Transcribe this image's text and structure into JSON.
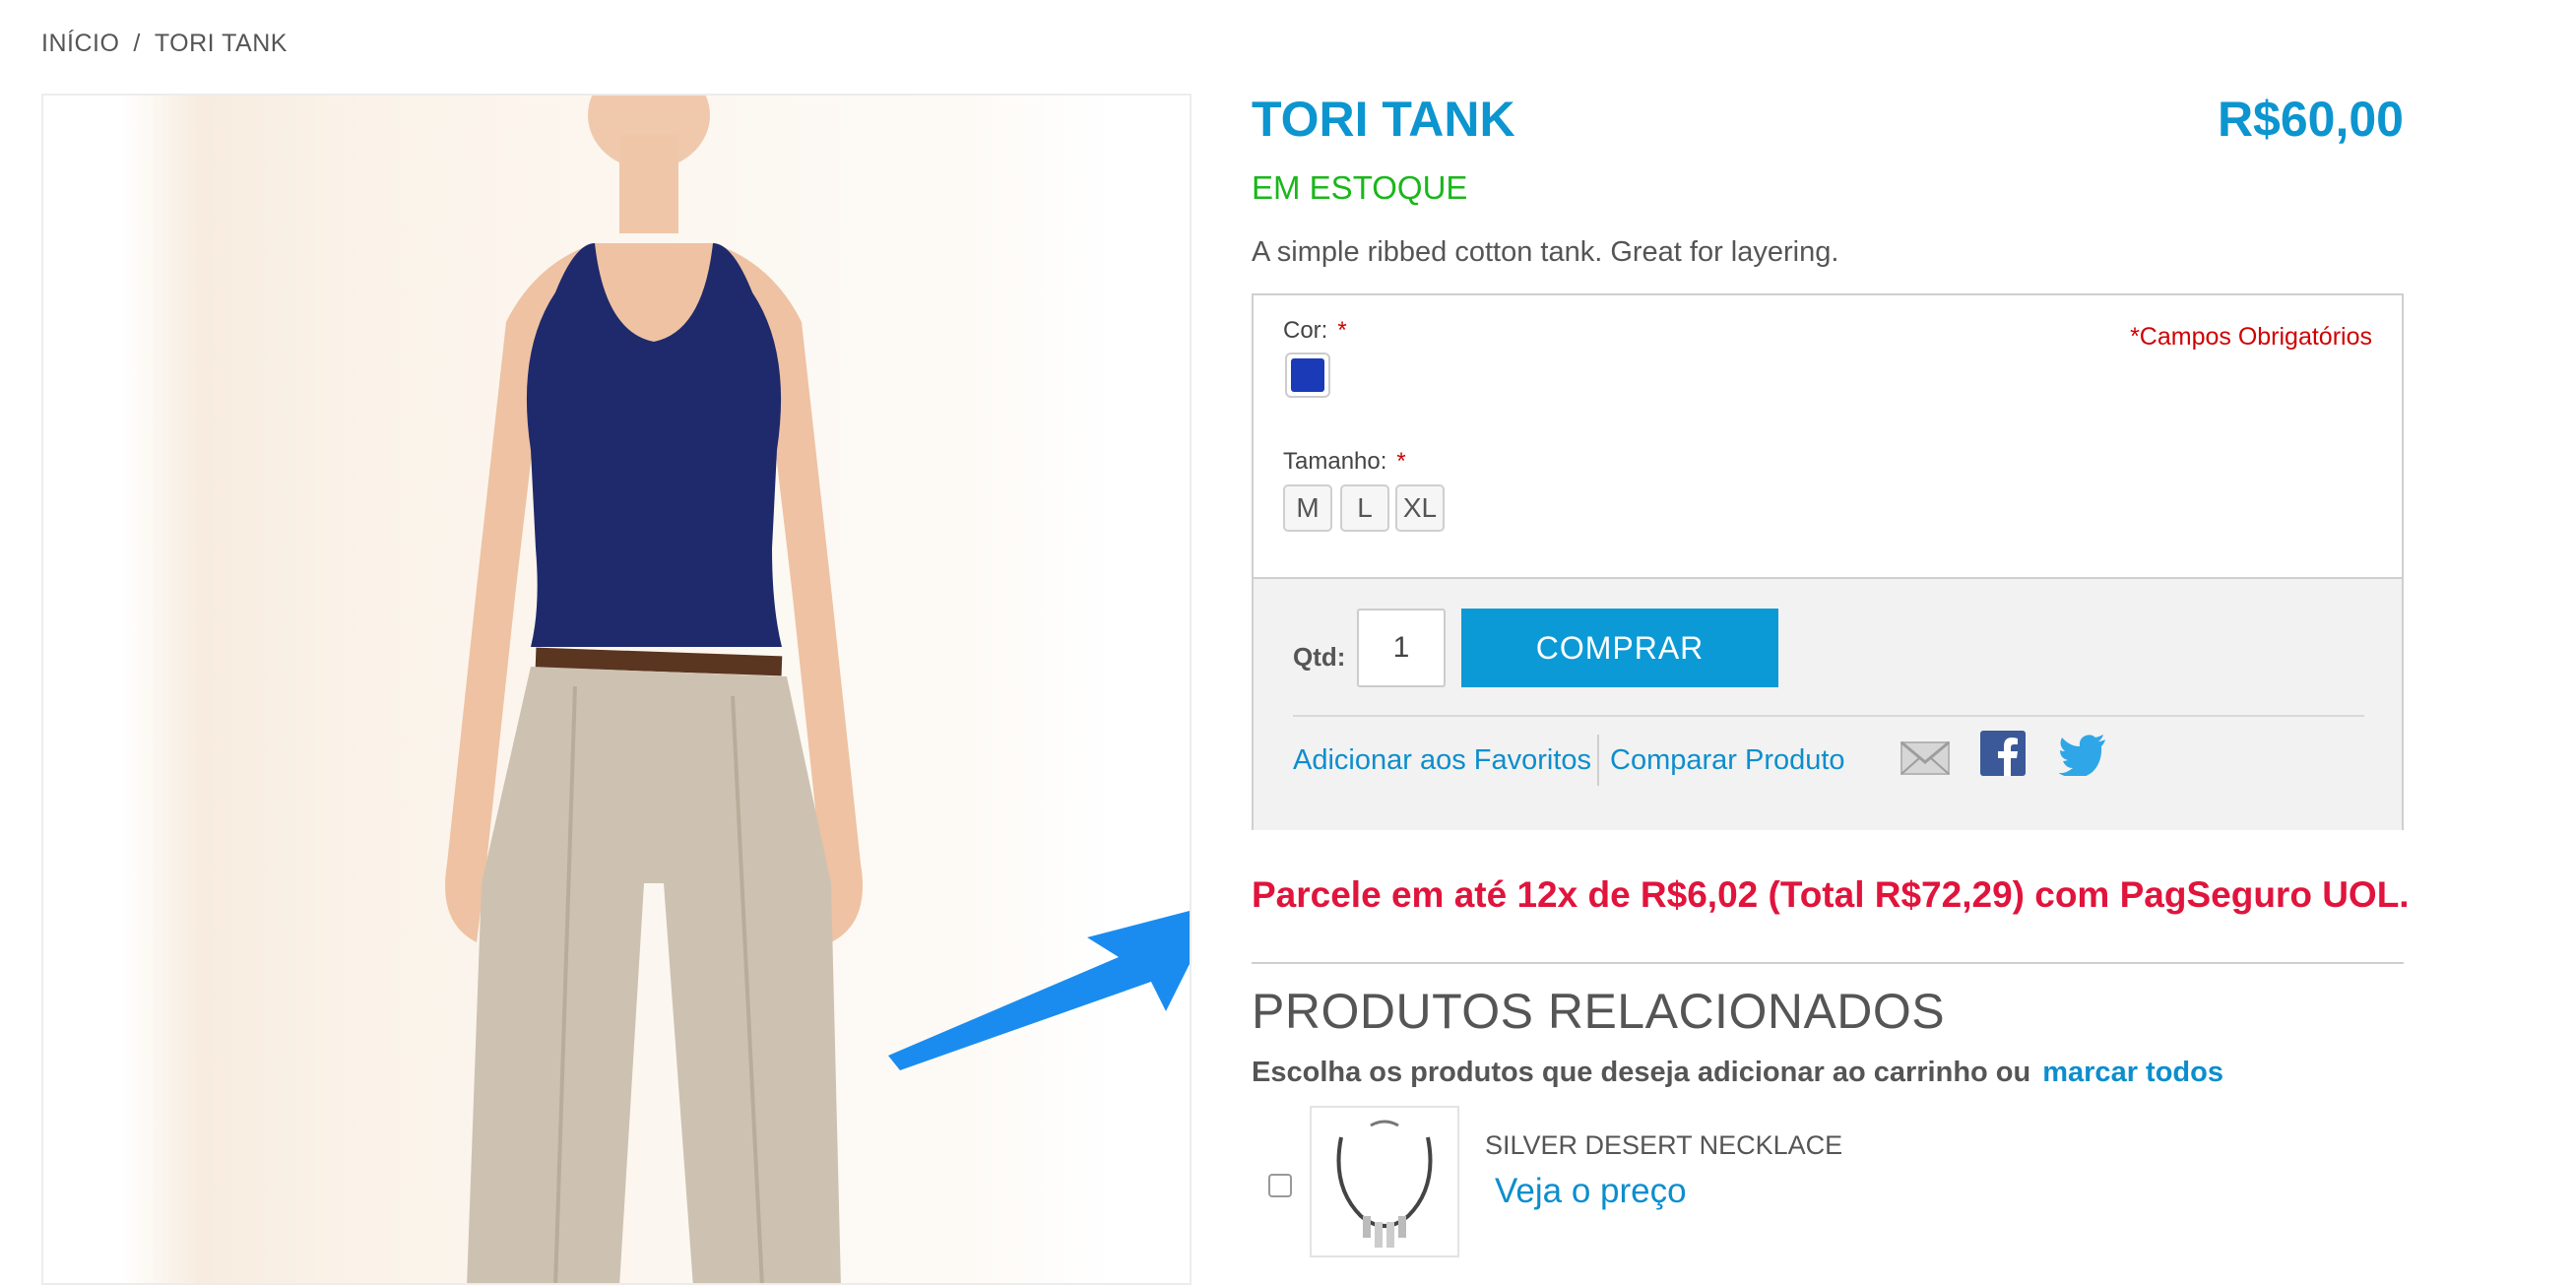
{
  "breadcrumb": {
    "home": "INÍCIO",
    "separator": "/",
    "current": "TORI TANK"
  },
  "product": {
    "title": "TORI TANK",
    "price": "R$60,00",
    "stock": "EM ESTOQUE",
    "description": "A simple ribbed cotton tank. Great for layering."
  },
  "options": {
    "color_label": "Cor:",
    "color_swatch": "#1b3ab8",
    "size_label": "Tamanho:",
    "required_marker": "*",
    "required_note": "*Campos Obrigatórios",
    "sizes": [
      "M",
      "L",
      "XL"
    ]
  },
  "purchase": {
    "qty_label": "Qtd:",
    "qty_value": "1",
    "buy_label": "COMPRAR",
    "wishlist_label": "Adicionar aos Favoritos",
    "compare_label": "Comparar Produto",
    "share_icons": [
      "email-icon",
      "facebook-icon",
      "twitter-icon"
    ]
  },
  "promo": "Parcele em até 12x de R$6,02 (Total R$72,29) com PagSeguro UOL.",
  "related": {
    "title": "PRODUTOS RELACIONADOS",
    "subtitle": "Escolha os produtos que deseja adicionar ao carrinho ou",
    "select_all": "marcar todos",
    "items": [
      {
        "name": "SILVER DESERT NECKLACE",
        "price_link": "Veja o preço"
      }
    ]
  },
  "colors": {
    "accent": "#0c95cf",
    "stock": "#1ab71a",
    "promo": "#e0143c",
    "required": "#d00000"
  }
}
